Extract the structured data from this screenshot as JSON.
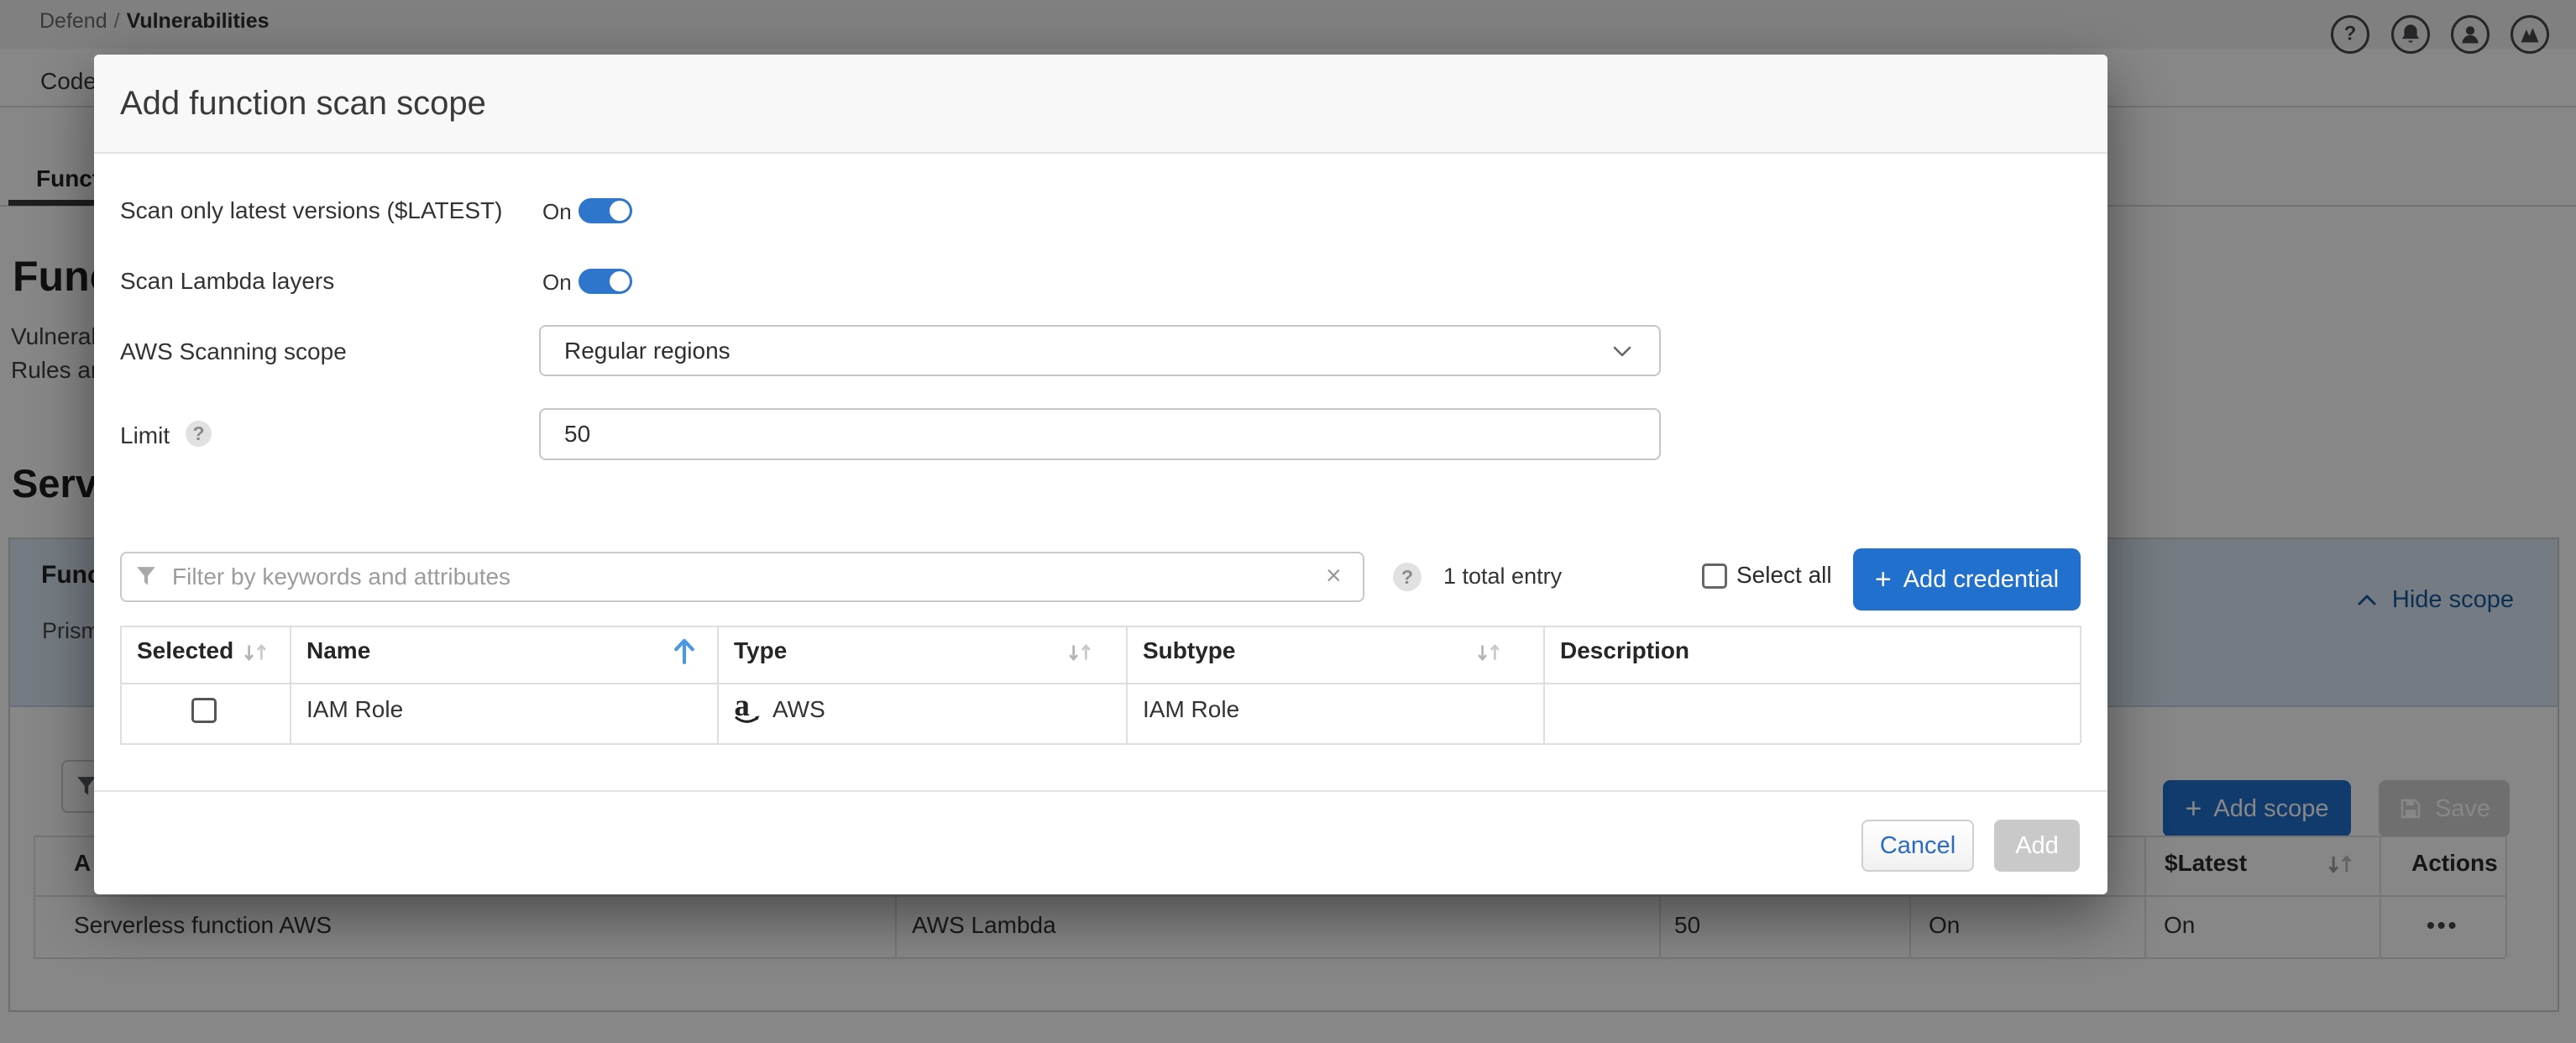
{
  "breadcrumb": {
    "section": "Defend",
    "separator": "/",
    "current": "Vulnerabilities"
  },
  "tabs": {
    "row1_visible_fragment": "Code",
    "row2_visible_fragment": "Funct"
  },
  "background": {
    "heading_fragment": "Func",
    "paragraph_fragment_1": "Vulneral",
    "paragraph_fragment_2": "Rules an",
    "section_heading_fragment": "Serve",
    "card": {
      "title_fragment": "Func",
      "subtitle_fragment": "Prism",
      "hide_scope_label": "Hide scope",
      "add_scope_label": "Add scope",
      "save_label": "Save"
    },
    "table": {
      "header_fragment": "A",
      "header_latest": "$Latest",
      "header_actions": "Actions",
      "row": {
        "name": "Serverless function AWS",
        "runtime": "AWS Lambda",
        "cap": "50",
        "layers": "On",
        "latest": "On",
        "actions": "•••"
      }
    }
  },
  "modal": {
    "title": "Add function scan scope",
    "rows": [
      {
        "label": "Scan only latest versions ($LATEST)",
        "state": "On"
      },
      {
        "label": "Scan Lambda layers",
        "state": "On"
      },
      {
        "label": "AWS Scanning scope",
        "value": "Regular regions"
      },
      {
        "label": "Limit",
        "help": "?",
        "value": "50"
      }
    ],
    "filter": {
      "placeholder": "Filter by keywords and attributes",
      "clear": "×",
      "help": "?",
      "total": "1 total entry",
      "select_all_label": "Select all",
      "add_credential_label": "Add credential"
    },
    "table": {
      "headers": [
        "Selected",
        "Name",
        "Type",
        "Subtype",
        "Description"
      ],
      "row": {
        "name": "IAM Role",
        "type": "AWS",
        "subtype": "IAM Role",
        "description": ""
      }
    },
    "footer": {
      "cancel": "Cancel",
      "add": "Add"
    }
  },
  "ui": {
    "plus": "+"
  },
  "colors": {
    "primary_blue": "#2170cd",
    "toggle_blue": "#2e76cc",
    "link_blue": "#17599f",
    "sort_active_blue": "#4a97e6",
    "disabled_gray": "#d2d2d2",
    "overlay": "rgba(0,0,0,0.47)"
  }
}
